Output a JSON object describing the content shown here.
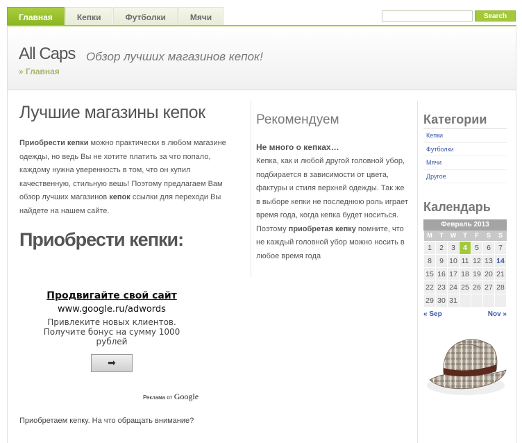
{
  "nav": {
    "tabs": [
      {
        "label": "Главная",
        "active": true
      },
      {
        "label": "Кепки"
      },
      {
        "label": "Футболки"
      },
      {
        "label": "Мячи"
      }
    ]
  },
  "search": {
    "placeholder": "",
    "button_label": "Search"
  },
  "header": {
    "site_title": "All Caps",
    "tagline": "Обзор лучших магазинов кепок!",
    "breadcrumb": "» Главная"
  },
  "main": {
    "title": "Лучшие магазины кепок",
    "intro_bold1": "Приобрести кепки",
    "intro_text1": " можно практически в любом магазине одежды, но ведь Вы не хотите платить за что попало, каждому нужна уверенность в том, что он купил качественную, стильную вешь! Поэтому предлагаем Вам обзор лучших магазинов ",
    "intro_bold2": "кепок",
    "intro_text2": " ссылки для переходи Вы найдете на нашем сайте.",
    "big_heading": "Приобрести кепки:",
    "bottom_link": "Приобретаем кепку. На что обращать внимание?"
  },
  "ad": {
    "title": "Продвигайте свой сайт",
    "url": "www.google.ru/adwords",
    "text": "Привлеките новых клиентов. Получите бонус на сумму 1000 рублей",
    "button": "➡",
    "footer_prefix": "Реклама от",
    "footer_brand": "Google"
  },
  "recommend": {
    "title": "Рекомендуем",
    "subtitle": "Не много о кепках…",
    "text1": "Кепка, как и любой другой головной убор, подбирается в зависимости от цвета, фактуры и стиля верхней одежды. Так же в выборе кепки не последнюю роль играет время года, когда кепка будет носиться. Поэтому ",
    "bold": "приобретая кепку",
    "text2": " помните, что не каждый головной убор можно носить в любое время года"
  },
  "categories": {
    "title": "Категории",
    "items": [
      "Кепки",
      "Футболки",
      "Мячи",
      "Другое"
    ]
  },
  "calendar": {
    "title": "Календарь",
    "month": "Февраль 2013",
    "weekdays": [
      "M",
      "T",
      "W",
      "T",
      "F",
      "S",
      "S"
    ],
    "rows": [
      [
        "1",
        "2",
        "3",
        "4",
        "5",
        "6",
        "7"
      ],
      [
        "8",
        "9",
        "10",
        "11",
        "12",
        "13",
        "14"
      ],
      [
        "15",
        "16",
        "17",
        "18",
        "19",
        "20",
        "21"
      ],
      [
        "22",
        "23",
        "24",
        "25",
        "26",
        "27",
        "28"
      ],
      [
        "29",
        "30",
        "31",
        "",
        "",
        "",
        ""
      ]
    ],
    "today": "4",
    "linked": [
      "14"
    ],
    "prev": "« Sep",
    "next": "Nov »"
  },
  "colors": {
    "accent": "#a4c83c",
    "link": "#3c5aa7"
  }
}
